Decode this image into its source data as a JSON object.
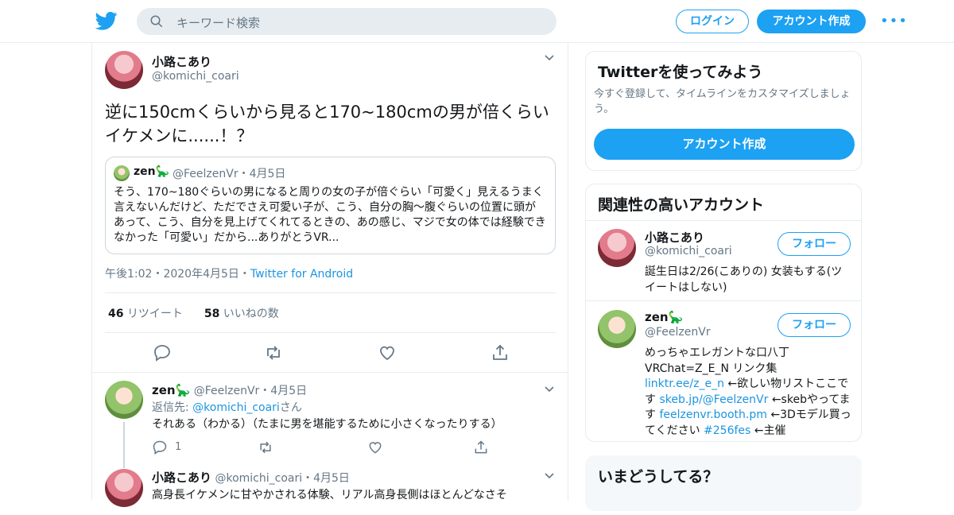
{
  "topbar": {
    "search_placeholder": "キーワード検索",
    "login_label": "ログイン",
    "signup_label": "アカウント作成",
    "more_label": "•••"
  },
  "tweet": {
    "author_name": "小路こあり",
    "author_handle": "@komichi_coari",
    "text": "逆に150cmくらいから見ると170~180cmの男が倍くらいイケメンに......！？",
    "quote": {
      "author_name": "zen🦕",
      "author_handle": "@FeelzenVr・4月5日",
      "text": "そう、170~180ぐらいの男になると周りの女の子が倍ぐらい「可愛く」見えるうまく言えないんだけど、ただでさえ可愛い子が、こう、自分の胸〜腹ぐらいの位置に頭があって、こう、自分を見上げてくれてるときの、あの感じ、マジで女の体では経験できなかった「可愛い」だから...ありがとうVR..."
    },
    "time": "午後1:02・2020年4月5日・",
    "source": "Twitter for Android",
    "retweet_count": "46",
    "retweet_label": "リツイート",
    "like_count": "58",
    "like_label": "いいねの数"
  },
  "replies": [
    {
      "name": "zen🦕",
      "handle": "@FeelzenVr・4月5日",
      "reply_to_prefix": "返信先: ",
      "reply_to_handle": "@komichi_coari",
      "reply_to_suffix": "さん",
      "text": "それある（わかる）（たまに男を堪能するために小さくなったりする）",
      "reply_count": "1"
    },
    {
      "name": "小路こあり",
      "handle": "@komichi_coari・4月5日",
      "text": "高身長イケメンに甘やかされる体験、リアル高身長側はほとんどなさそ"
    }
  ],
  "sidebar": {
    "try_title": "Twitterを使ってみよう",
    "try_sub": "今すぐ登録して、タイムラインをカスタマイズしましょう。",
    "try_button": "アカウント作成",
    "related_title": "関連性の高いアカウント",
    "follow_label": "フォロー",
    "accounts": [
      {
        "name": "小路こあり",
        "handle": "@komichi_coari",
        "bio": "誕生日は2/26(こありの) 女装もする(ツイートはしない)"
      },
      {
        "name": "zen🦕",
        "handle": "@FeelzenVr",
        "bio_1": "めっちゃエレガントな口八丁 VRChat=Z_E_N リンク集",
        "link_1": "linktr.ee/z_e_n",
        "bio_2": " ←欲しい物リストここです ",
        "link_2": "skeb.jp/@FeelzenVr",
        "bio_3": " ←skebやってます ",
        "link_3": "feelzenvr.booth.pm",
        "bio_4": " ←3Dモデル買ってください ",
        "link_4": "#256fes",
        "bio_5": " ←主催"
      }
    ],
    "whats_happening_title": "いまどうしてる？"
  }
}
